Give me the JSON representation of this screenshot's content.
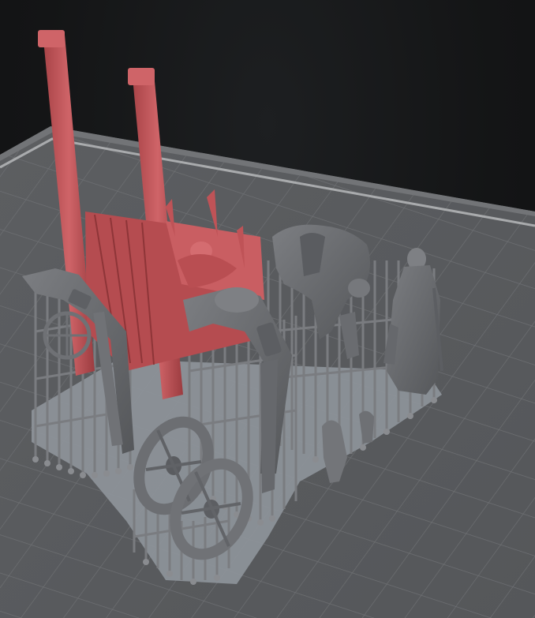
{
  "viewport": {
    "background_color": "#141516",
    "build_plate_color": "#5a5c5f",
    "build_plate_grid_color": "#6e7073",
    "build_plate_border_color": "#a9abad",
    "selected_model_color": "#c2585c",
    "model_color": "#6a6c6f",
    "support_color": "#7a7c80",
    "raft_color": "#8f959b"
  },
  "models": [
    {
      "name": "gallows-frame",
      "selected": true
    },
    {
      "name": "wheel-torture-device",
      "selected": false
    },
    {
      "name": "horse-figure",
      "selected": false
    },
    {
      "name": "robed-figure",
      "selected": false
    },
    {
      "name": "cart-wheel-left",
      "selected": false
    },
    {
      "name": "cart-wheel-right",
      "selected": false
    },
    {
      "name": "small-figure",
      "selected": false
    }
  ]
}
